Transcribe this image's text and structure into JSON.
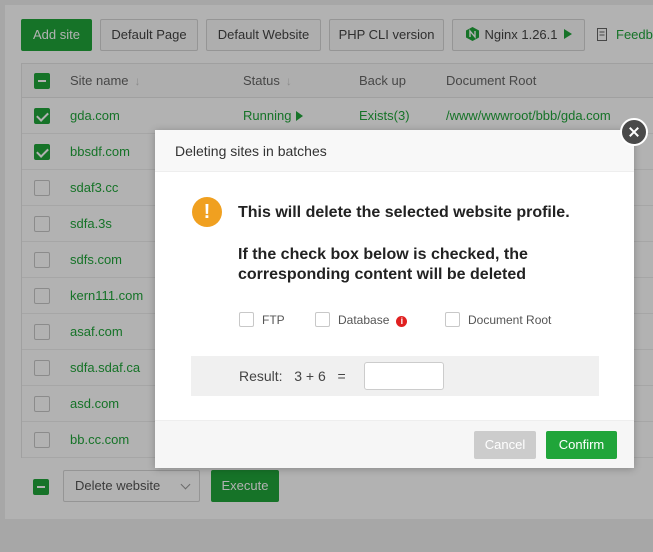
{
  "toolbar": {
    "add_site": "Add site",
    "default_page": "Default Page",
    "default_website": "Default Website",
    "php_cli": "PHP CLI version",
    "nginx": "Nginx 1.26.1",
    "feedback": "Feedb"
  },
  "table": {
    "headers": {
      "site_name": "Site name",
      "status": "Status",
      "backup": "Back up",
      "doc_root": "Document Root"
    },
    "rows": [
      {
        "name": "gda.com",
        "checked": true,
        "status": "Running",
        "backup": "Exists(3)",
        "root": "/www/wwwroot/bbb/gda.com"
      },
      {
        "name": "bbsdf.com",
        "checked": true
      },
      {
        "name": "sdaf3.cc",
        "checked": false
      },
      {
        "name": "sdfa.3s",
        "checked": false
      },
      {
        "name": "sdfs.com",
        "checked": false
      },
      {
        "name": "kern111.com",
        "checked": false
      },
      {
        "name": "asaf.com",
        "checked": false
      },
      {
        "name": "sdfa.sdaf.ca",
        "checked": false
      },
      {
        "name": "asd.com",
        "checked": false
      },
      {
        "name": "bb.cc.com",
        "checked": false
      }
    ]
  },
  "batch": {
    "select_value": "Delete website",
    "execute": "Execute"
  },
  "dialog": {
    "title": "Deleting sites in batches",
    "warning_icon": "!",
    "message_line1": "This will delete the selected website profile.",
    "message_line2": "If the check box below is checked, the corresponding content will be deleted",
    "options": {
      "ftp": "FTP",
      "database": "Database",
      "document_root": "Document Root"
    },
    "info_icon": "i",
    "result_label": "Result:   3 + 6   =",
    "cancel": "Cancel",
    "confirm": "Confirm"
  },
  "colors": {
    "accent": "#20a53a",
    "warning": "#f0a020",
    "danger": "#e02020"
  }
}
